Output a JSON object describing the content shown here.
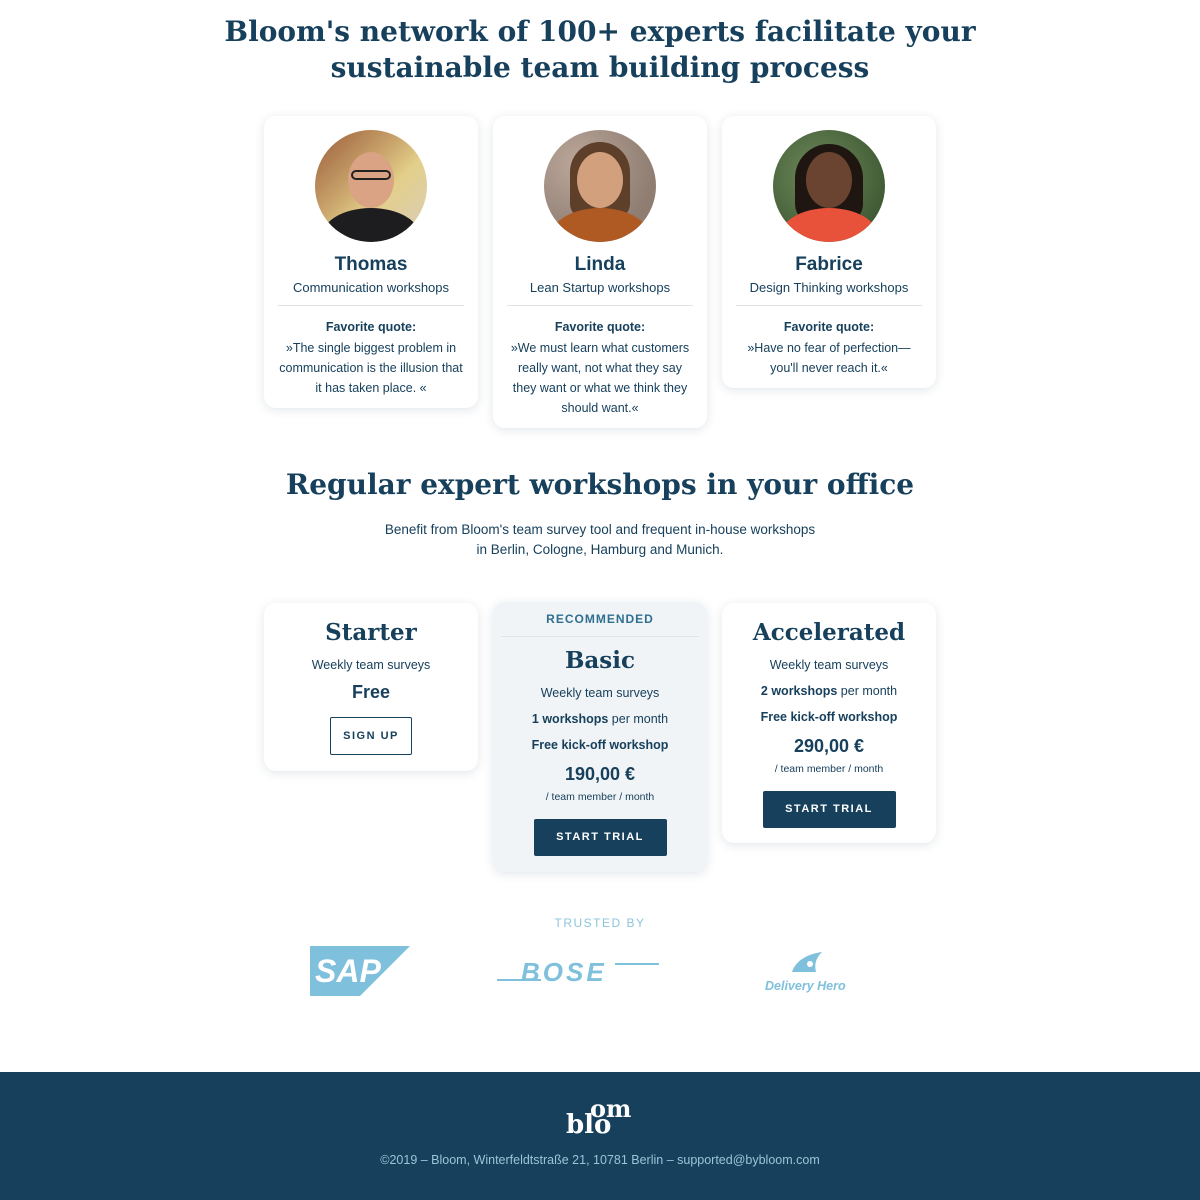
{
  "headline": {
    "line1": "Bloom's network of 100+ experts facilitate your",
    "line2": "sustainable team building process"
  },
  "experts": [
    {
      "name": "Thomas",
      "topic": "Communication workshops",
      "quote_label": "Favorite quote:",
      "quote": "»The single biggest problem in communication is the illusion that it has taken place. «"
    },
    {
      "name": "Linda",
      "topic": "Lean Startup workshops",
      "quote_label": "Favorite quote:",
      "quote": "»We must learn what customers really want, not what they say they want or what we think they should want.«"
    },
    {
      "name": "Fabrice",
      "topic": "Design Thinking workshops",
      "quote_label": "Favorite quote:",
      "quote": "»Have no fear of perfection—you'll never reach it.«"
    }
  ],
  "workshops": {
    "title": "Regular expert workshops in your office",
    "subtitle": "Benefit from Bloom's team survey tool and frequent in-house workshops in Berlin, Cologne, Hamburg and Munich."
  },
  "plans": {
    "starter": {
      "title": "Starter",
      "feature": "Weekly team surveys",
      "price": "Free",
      "button": "SIGN UP"
    },
    "basic": {
      "badge": "RECOMMENDED",
      "title": "Basic",
      "feature": "Weekly team surveys",
      "workshops_bold": "1 workshops",
      "workshops_rest": " per month",
      "kickoff": "Free kick-off workshop",
      "price": "190,00 €",
      "unit": "/ team member / month",
      "button": "START TRIAL"
    },
    "accelerated": {
      "title": "Accelerated",
      "feature": "Weekly team surveys",
      "workshops_bold": "2 workshops",
      "workshops_rest": " per month",
      "kickoff": "Free kick-off workshop",
      "price": "290,00 €",
      "unit": "/ team member / month",
      "button": "START TRIAL"
    }
  },
  "trusted": {
    "label": "TRUSTED BY",
    "logos": [
      "SAP",
      "BOSE",
      "Delivery Hero"
    ],
    "logo_color": "#7fc0dc"
  },
  "footer": {
    "logo_part1": "blo",
    "logo_part2": "om",
    "copyright": "©2019 – Bloom, Winterfeldtstraße 21, 10781 Berlin – supported@bybloom.com",
    "background": "#17405c"
  }
}
